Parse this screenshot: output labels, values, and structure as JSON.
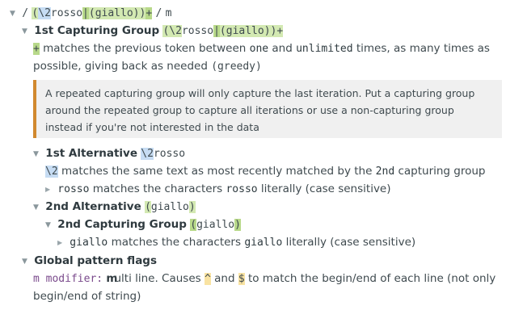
{
  "regex": {
    "open_slash": "/",
    "paren_open": "(",
    "backref": "\\2",
    "rosso": "rosso",
    "pipe": "|",
    "giallo_group": "(giallo)",
    "paren_close": ")",
    "plus": "+",
    "close_slash": "/",
    "flag": "m"
  },
  "group1": {
    "title": "1st Capturing Group",
    "pattern_a": "(\\2",
    "pattern_b": "rosso",
    "pattern_c": "|",
    "pattern_d": "(giallo",
    "pattern_e": "))+"
  },
  "quantifier": {
    "token": "+",
    "text1": "matches the previous token between",
    "one": "one",
    "and": "and",
    "unlimited": "unlimited",
    "text2": "times, as many times as",
    "text3": "possible, giving back as needed",
    "greedy": "(greedy)"
  },
  "note": {
    "text": "A repeated capturing group will only capture the last iteration. Put a capturing group around the repeated group to capture all iterations or use a non-capturing group instead if you're not interested in the data"
  },
  "alt1": {
    "title": "1st Alternative",
    "pattern_a": "\\2",
    "pattern_b": "rosso",
    "backref_token": "\\2",
    "backref_text_a": "matches the same text as most recently matched by the",
    "backref_group": "2nd",
    "backref_text_b": "capturing group",
    "literal_token": "rosso",
    "literal_text_a": "matches the characters",
    "literal_chars": "rosso",
    "literal_text_b": "literally (case sensitive)"
  },
  "alt2": {
    "title": "2nd Alternative",
    "pattern_a": "(",
    "pattern_b": "giallo",
    "pattern_c": ")",
    "group2_title": "2nd Capturing Group",
    "group2_a": "(",
    "group2_b": "giallo",
    "group2_c": ")",
    "literal_token": "giallo",
    "literal_text_a": "matches the characters",
    "literal_chars": "giallo",
    "literal_text_b": "literally (case sensitive)"
  },
  "flags": {
    "title": "Global pattern flags",
    "modifier": "m modifier:",
    "m": "m",
    "text1": "ulti line. Causes",
    "caret": "^",
    "and": "and",
    "dollar": "$",
    "text2": "to match the begin/end of each line (not only",
    "text3": "begin/end of string)"
  },
  "colors": {
    "blue_highlight": "#c6dcf3",
    "green_highlight": "#b8d98a",
    "yellow_highlight": "#f9e3a2",
    "note_border": "#d1892f",
    "modifier_purple": "#7a4a8c"
  }
}
